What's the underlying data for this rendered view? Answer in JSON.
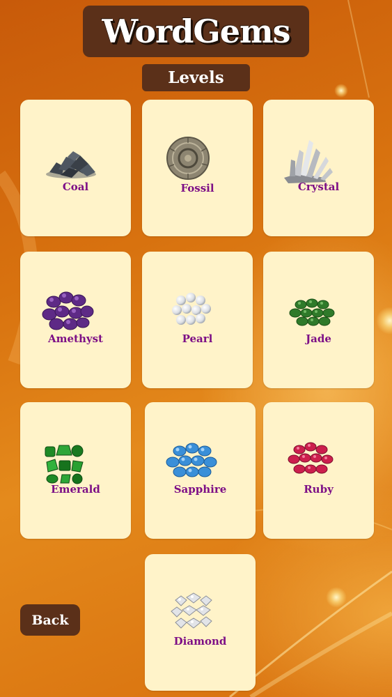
{
  "header": {
    "title": "WordGems",
    "subtitle": "Levels"
  },
  "levels": [
    {
      "label": "Coal",
      "icon": "coal-icon"
    },
    {
      "label": "Fossil",
      "icon": "fossil-icon"
    },
    {
      "label": "Crystal",
      "icon": "crystal-icon"
    },
    {
      "label": "Amethyst",
      "icon": "amethyst-icon"
    },
    {
      "label": "Pearl",
      "icon": "pearl-icon"
    },
    {
      "label": "Jade",
      "icon": "jade-icon"
    },
    {
      "label": "Emerald",
      "icon": "emerald-icon"
    },
    {
      "label": "Sapphire",
      "icon": "sapphire-icon"
    },
    {
      "label": "Ruby",
      "icon": "ruby-icon"
    },
    {
      "label": "Diamond",
      "icon": "diamond-icon"
    }
  ],
  "back": {
    "label": "Back"
  },
  "colors": {
    "panel": "#5b3019",
    "card": "#fff3c9",
    "label": "#7d0f86",
    "background": "#d8720f"
  }
}
